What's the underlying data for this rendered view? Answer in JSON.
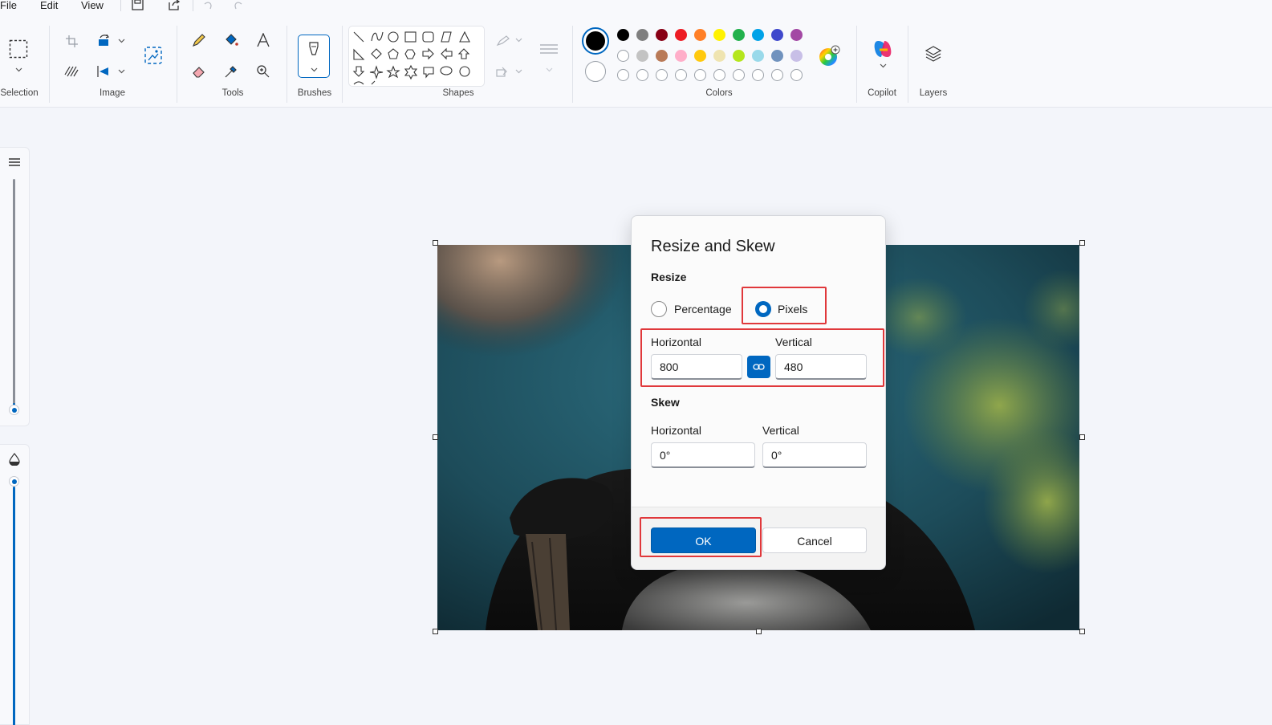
{
  "menu": {
    "file": "File",
    "edit": "Edit",
    "view": "View"
  },
  "groups": {
    "selection": "Selection",
    "image": "Image",
    "tools": "Tools",
    "brushes": "Brushes",
    "shapes": "Shapes",
    "colors": "Colors",
    "copilot": "Copilot",
    "layers": "Layers"
  },
  "palette": {
    "row1": [
      "#000000",
      "#7f7f7f",
      "#880015",
      "#ed1c24",
      "#ff7f27",
      "#fff200",
      "#22b14c",
      "#00a2e8",
      "#3f48cc",
      "#a349a4"
    ],
    "row2": [
      "#ffffff",
      "#c3c3c3",
      "#b97a57",
      "#ffaec9",
      "#ffc90e",
      "#efe4b0",
      "#b5e61d",
      "#99d9ea",
      "#7092be",
      "#c8bfe7"
    ],
    "row3_empty_count": 10,
    "primary": "#000000",
    "secondary": "#ffffff",
    "accent": "#0067c0"
  },
  "dialog": {
    "title": "Resize and Skew",
    "resize_heading": "Resize",
    "percentage_label": "Percentage",
    "pixels_label": "Pixels",
    "selected_mode": "Pixels",
    "resize_horizontal_label": "Horizontal",
    "resize_vertical_label": "Vertical",
    "resize_horizontal_value": "800",
    "resize_vertical_value": "480",
    "maintain_aspect_ratio": true,
    "skew_heading": "Skew",
    "skew_horizontal_label": "Horizontal",
    "skew_vertical_label": "Vertical",
    "skew_horizontal_value": "0°",
    "skew_vertical_value": "0°",
    "ok_label": "OK",
    "cancel_label": "Cancel"
  },
  "highlight_color": "#e0383b"
}
